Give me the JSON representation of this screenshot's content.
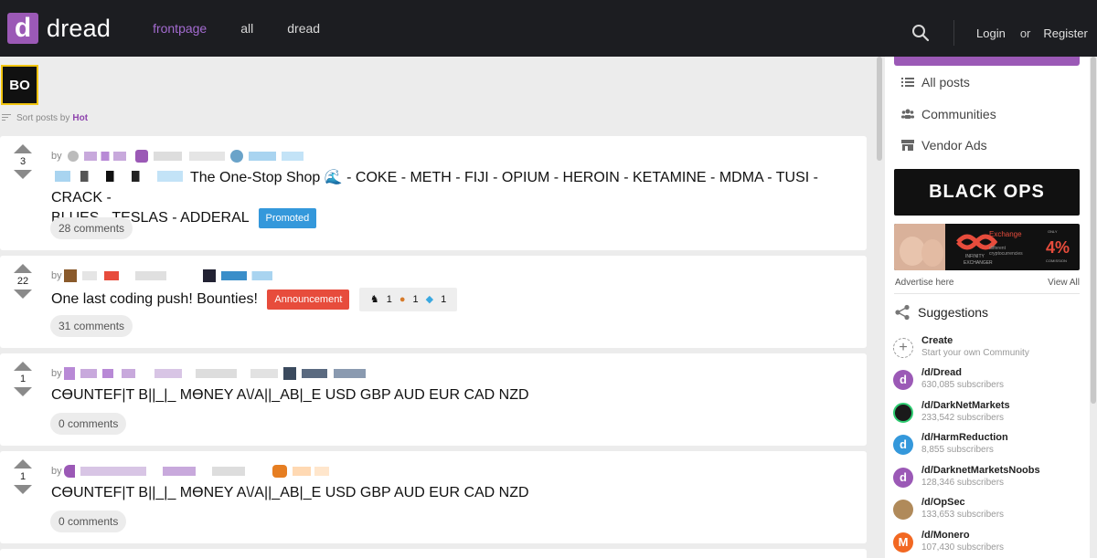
{
  "header": {
    "logo_letter": "d",
    "logo_text": "dread",
    "nav": [
      "frontpage",
      "all",
      "dread"
    ],
    "login": "Login",
    "or": "or",
    "register": "Register"
  },
  "main": {
    "avatar_text": "BO",
    "sort_prefix": "Sort posts by",
    "sort_value": "Hot",
    "posts": [
      {
        "votes": "3",
        "by": "by",
        "title": "The One-Stop Shop 🌊 - COKE - METH - FIJI - OPIUM - HEROIN - KETAMINE - MDMA - TUSI - CRACK -",
        "title_line2": "BLUES - TESLAS - ADDERAL",
        "badge": "Promoted",
        "comments": "28 comments"
      },
      {
        "votes": "22",
        "by": "by",
        "title": "One last coding push! Bounties!",
        "badge": "Announcement",
        "award_counts": [
          "1",
          "1",
          "1"
        ],
        "comments": "31 comments"
      },
      {
        "votes": "1",
        "by": "by",
        "title": "CӨUNTEF|T B||_|_ MӨNEY A\\/A||_AB|_E USD GBP AUD EUR CAD NZD",
        "comments": "0 comments"
      },
      {
        "votes": "1",
        "by": "by",
        "title": "CӨUNTEF|T B||_|_ MӨNEY A\\/A||_AB|_E USD GBP AUD EUR CAD NZD",
        "comments": "0 comments"
      }
    ]
  },
  "sidebar": {
    "menu": [
      "All posts",
      "Communities",
      "Vendor Ads"
    ],
    "banner1_text": "BLACK OPS",
    "banner2_texts": [
      "Exchange",
      "different",
      "cryptocurrencies",
      "INFINITY",
      "EXCHANGER",
      "ONLY",
      "4%",
      "COMISSION"
    ],
    "advertise": "Advertise here",
    "view_all": "View All",
    "suggestions_title": "Suggestions",
    "suggestions": [
      {
        "name": "Create",
        "sub": "Start your own Community"
      },
      {
        "name": "/d/Dread",
        "sub": "630,085 subscribers"
      },
      {
        "name": "/d/DarkNetMarkets",
        "sub": "233,542 subscribers"
      },
      {
        "name": "/d/HarmReduction",
        "sub": "8,855 subscribers"
      },
      {
        "name": "/d/DarknetMarketsNoobs",
        "sub": "128,346 subscribers"
      },
      {
        "name": "/d/OpSec",
        "sub": "133,653 subscribers"
      },
      {
        "name": "/d/Monero",
        "sub": "107,430 subscribers"
      }
    ]
  },
  "colors": {
    "accent": "#9b59b6",
    "topbar": "#1c1d21",
    "promoted": "#3498db",
    "announcement": "#e74c3c"
  }
}
